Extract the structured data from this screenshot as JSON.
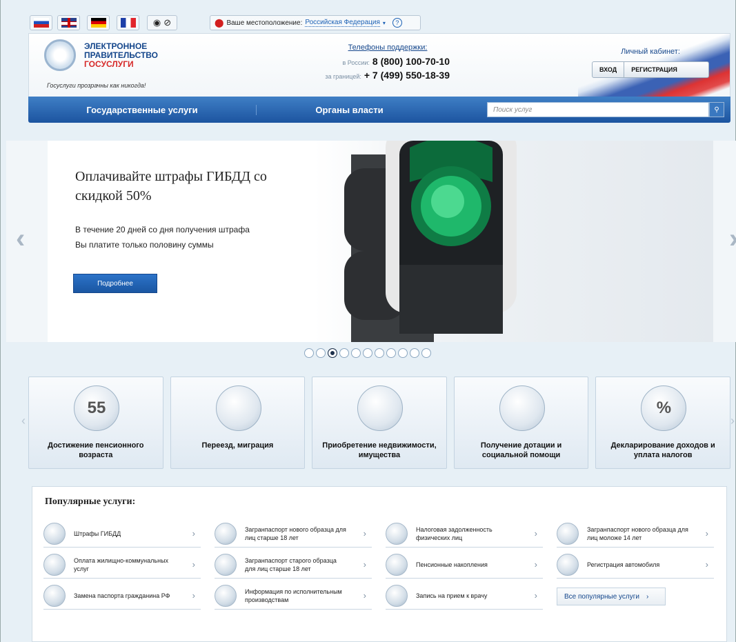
{
  "topbar": {
    "languages": [
      "ru",
      "en",
      "de",
      "fr"
    ],
    "tools": [
      "eye-icon",
      "compass-icon"
    ],
    "location_label": "Ваше местоположение:",
    "location_value": "Российская Федерация",
    "help": "?"
  },
  "header": {
    "logo_line1": "ЭЛЕКТРОННОЕ",
    "logo_line2": "ПРАВИТЕЛЬСТВО",
    "logo_line3": "ГОСУСЛУГИ",
    "slogan": "Госуслуги прозрачны как никогда!",
    "support_title": "Телефоны поддержки:",
    "support_ru_label": "в России:",
    "support_ru_phone": "8 (800) 100-70-10",
    "support_abroad_label": "за границей:",
    "support_abroad_phone": "+ 7 (499) 550-18-39",
    "cabinet_title": "Личный кабинет:",
    "login": "ВХОД",
    "register": "РЕГИСТРАЦИЯ"
  },
  "nav": {
    "services": "Государственные услуги",
    "authorities": "Органы власти",
    "search_placeholder": "Поиск услуг"
  },
  "banner": {
    "title": "Оплачивайте штрафы ГИБДД со скидкой 50%",
    "sub1": "В течение 20 дней со дня получения штрафа",
    "sub2": "Вы платите только половину суммы",
    "button": "Подробнее",
    "dots_total": 11,
    "dots_active": 2
  },
  "categories": [
    {
      "label": "Достижение пенсионного возраста",
      "icon": "55"
    },
    {
      "label": "Переезд, миграция",
      "icon": "passport-icon"
    },
    {
      "label": "Приобретение недвижимости, имущества",
      "icon": "keys-icon"
    },
    {
      "label": "Получение дотации и социальной помощи",
      "icon": "lifebuoy-icon"
    },
    {
      "label": "Декларирование доходов и уплата налогов",
      "icon": "%"
    }
  ],
  "popular": {
    "title": "Популярные услуги:",
    "items": [
      "Штрафы ГИБДД",
      "Загранпаспорт нового образца для лиц старше 18 лет",
      "Налоговая задолженность физических лиц",
      "Загранпаспорт нового образца для лиц моложе 14 лет",
      "Оплата жилищно-коммунальных услуг",
      "Загранпаспорт старого образца для лиц старше 18 лет",
      "Пенсионные накопления",
      "Регистрация автомобиля",
      "Замена паспорта гражданина РФ",
      "Информация по исполнительным производствам",
      "Запись на прием к врачу"
    ],
    "all_button": "Все популярные услуги"
  }
}
